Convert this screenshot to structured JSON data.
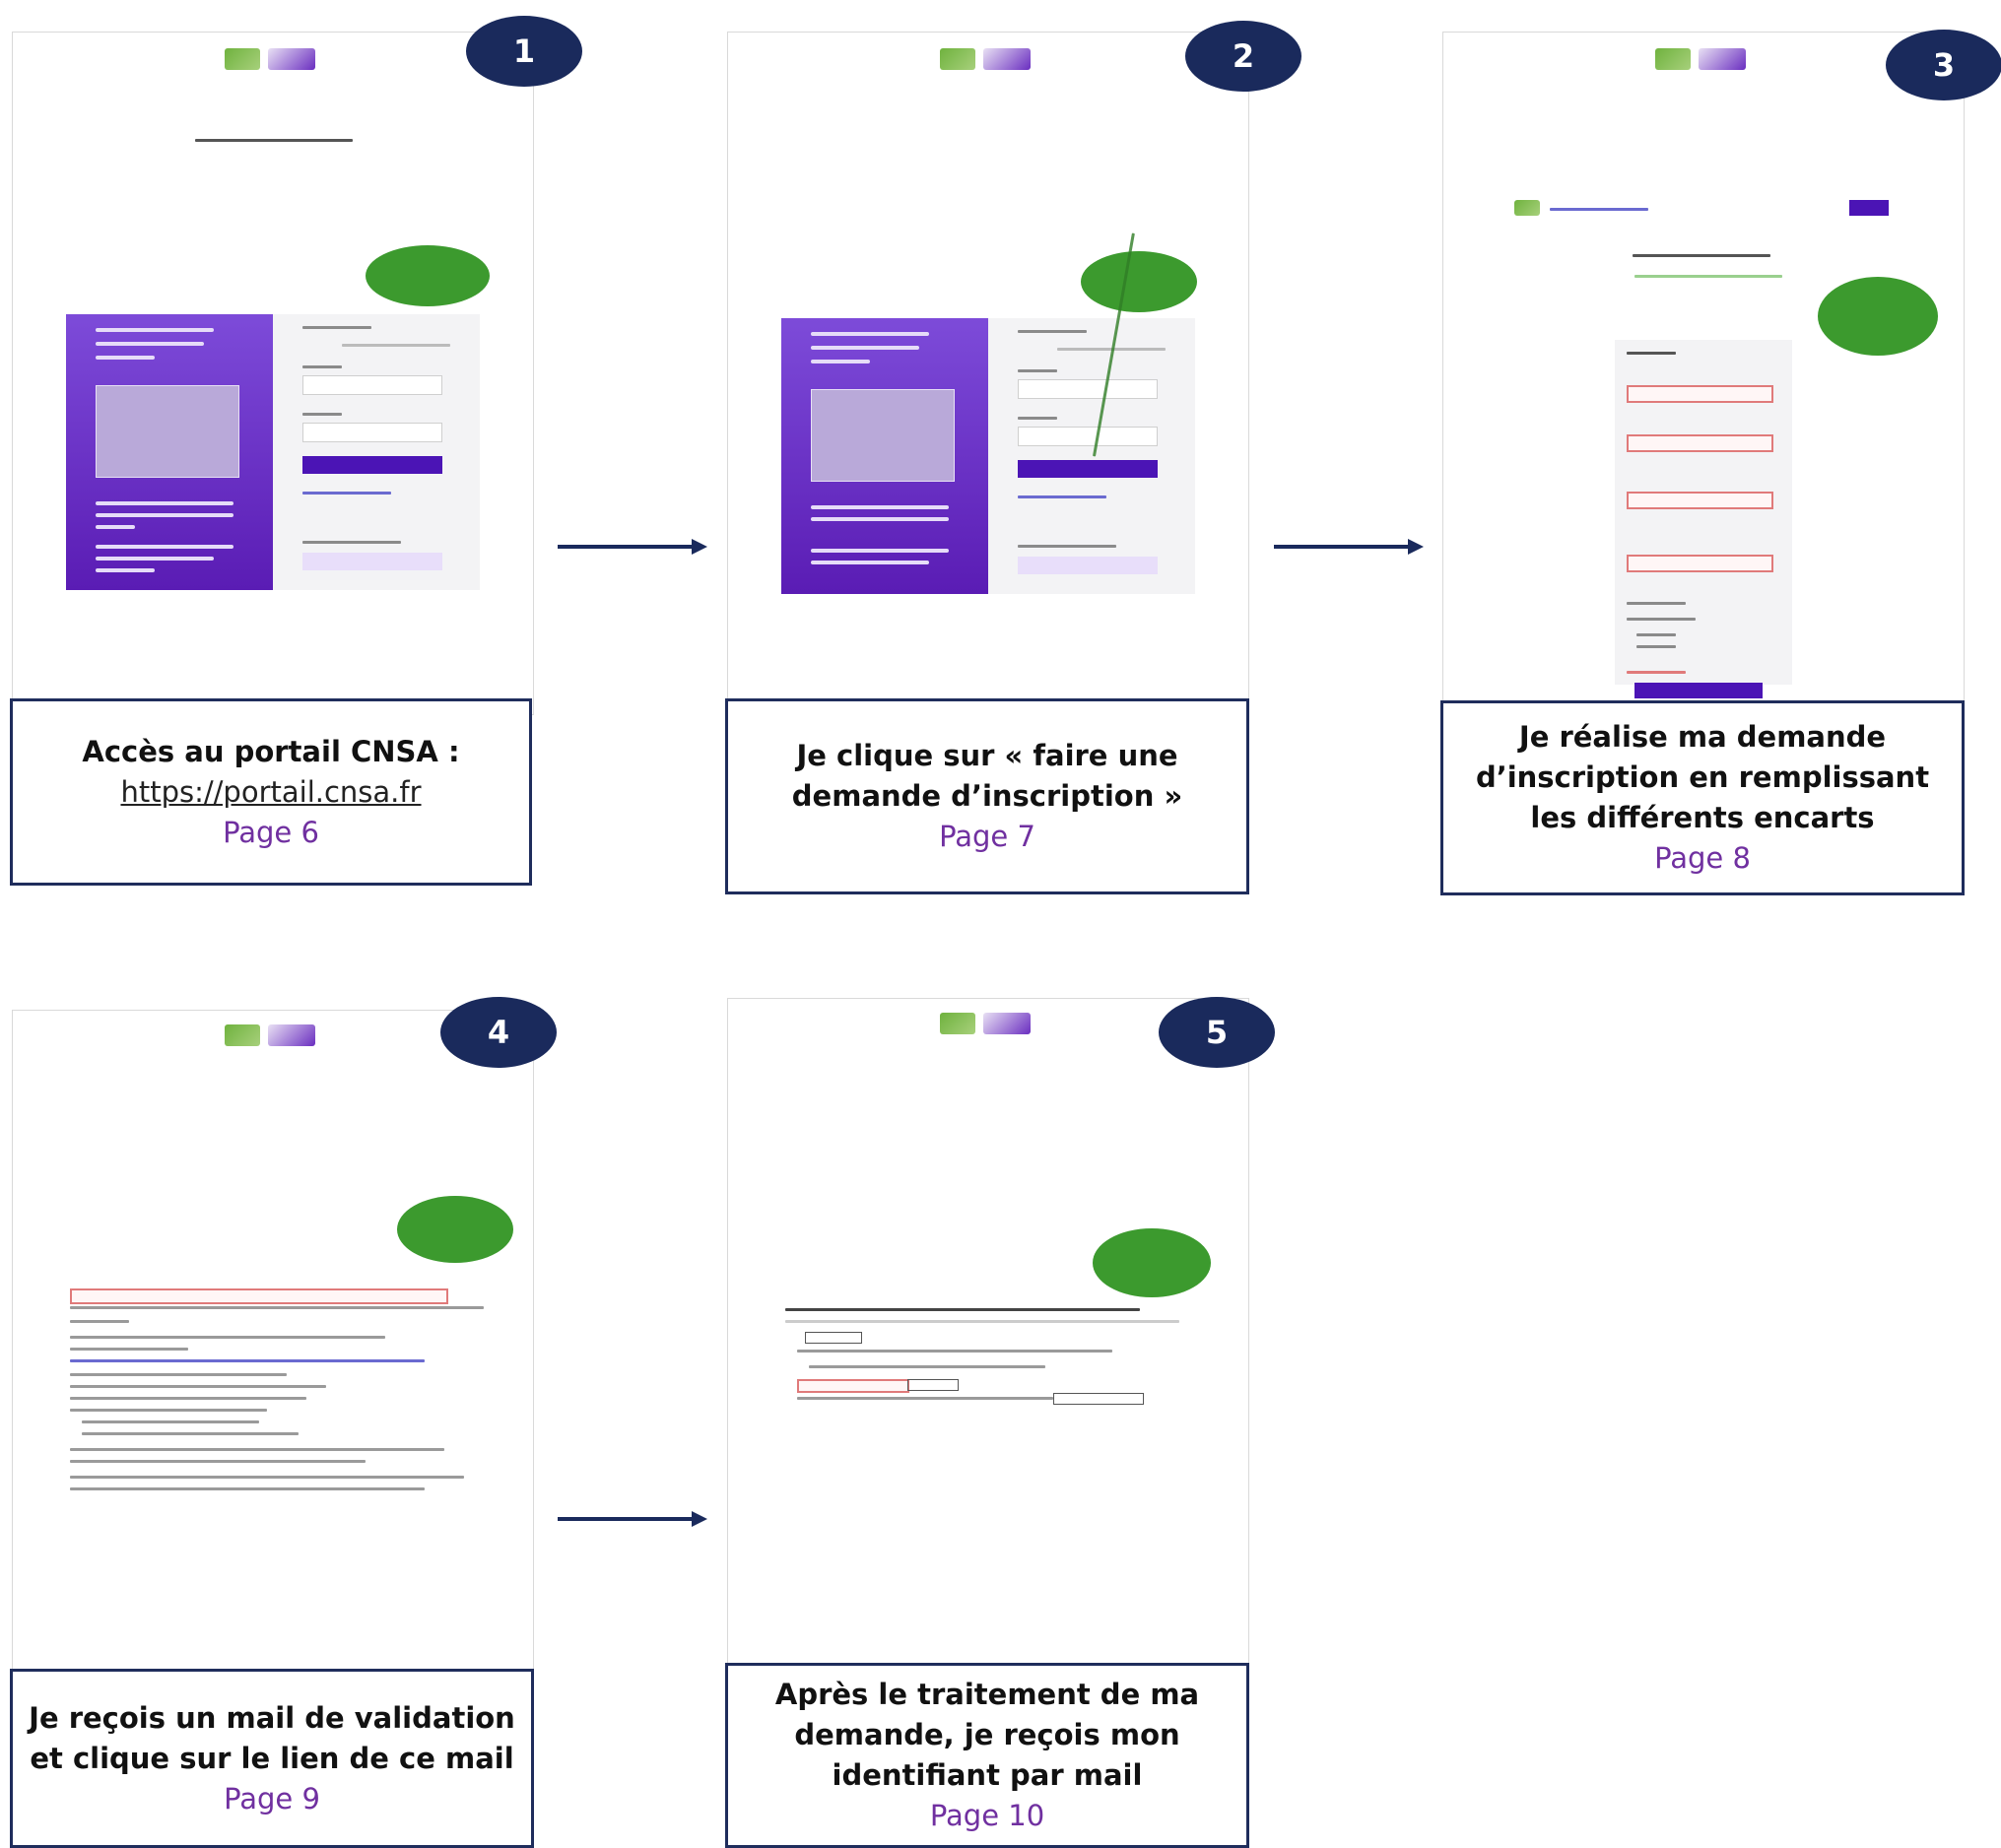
{
  "steps": [
    {
      "number": "1",
      "title": "Accès au portail CNSA :",
      "link": "https://portail.cnsa.fr",
      "page": "Page 6"
    },
    {
      "number": "2",
      "title": "Je clique sur « faire une\ndemande d’inscription »",
      "page": "Page 7"
    },
    {
      "number": "3",
      "title": "Je réalise ma demande\nd’inscription en remplissant\nles différents encarts",
      "page": "Page 8"
    },
    {
      "number": "4",
      "title": "Je reçois un mail de validation\net clique sur le lien de ce mail",
      "page": "Page 9"
    },
    {
      "number": "5",
      "title": "Après le traitement de ma\ndemande, je reçois mon\nidentifiant par mail",
      "page": "Page 10"
    }
  ],
  "colors": {
    "badge": "#1a2a5c",
    "caption_border": "#1f2d5c",
    "page_link": "#7030a0",
    "portal_purple": "#5a1cb4",
    "callout_green": "#3c9a2e"
  }
}
